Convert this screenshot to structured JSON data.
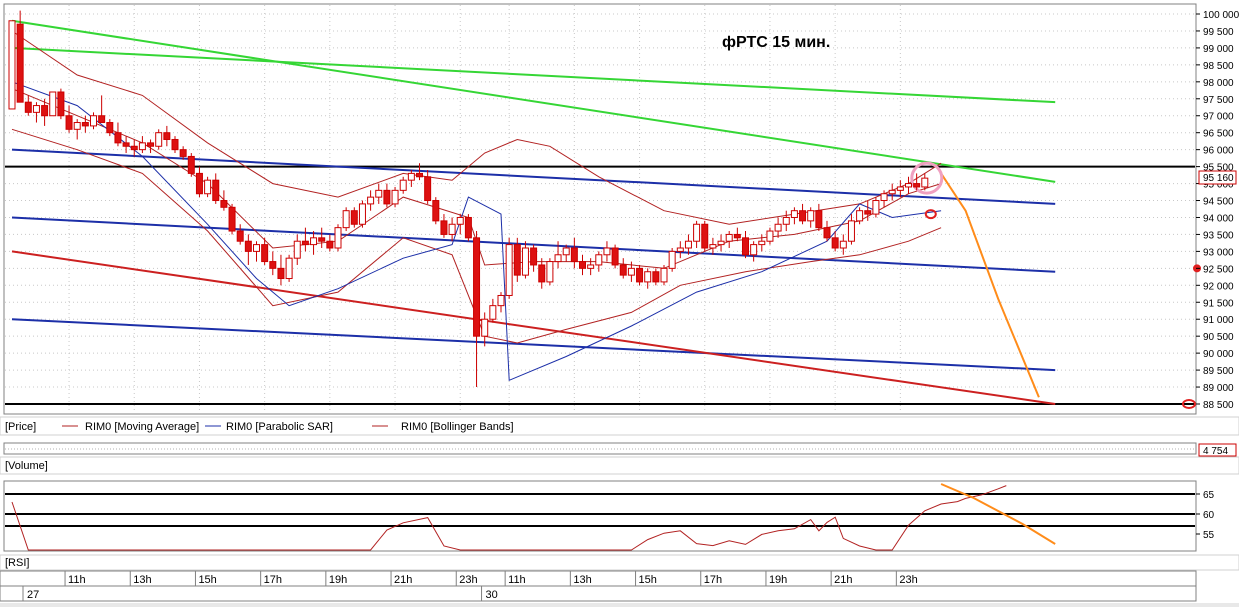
{
  "chart_data": {
    "type": "candlestick",
    "title": "фРТС   15 мин.",
    "instrument": "RIM0",
    "price_axis": {
      "ylim": [
        88500,
        100000
      ],
      "ticks": [
        100000,
        99500,
        99000,
        98500,
        98000,
        97500,
        97000,
        96500,
        96000,
        95500,
        95000,
        94500,
        94000,
        93500,
        93000,
        92500,
        92000,
        91500,
        91000,
        90500,
        90000,
        89500,
        89000,
        88500
      ],
      "tick_labels": [
        "100 000",
        "99 500",
        "99 000",
        "98 500",
        "98 000",
        "97 500",
        "97 000",
        "96 500",
        "96 000",
        "95 500",
        "95 000",
        "94 500",
        "94 000",
        "93 500",
        "93 000",
        "92 500",
        "92 000",
        "91 500",
        "91 000",
        "90 500",
        "90 000",
        "89 500",
        "89 000",
        "88 500"
      ],
      "last_price_label": "95 160",
      "last_price": 95160
    },
    "legend": [
      {
        "label": "[Price]",
        "color": "#000000"
      },
      {
        "label": "RIM0 [Moving Average]",
        "color": "#b22222"
      },
      {
        "label": "RIM0 [Parabolic SAR]",
        "color": "#1c2fa8"
      },
      {
        "label": "RIM0 [Bollinger Bands]",
        "color": "#b22222"
      }
    ],
    "volume_panel": {
      "title": "[Volume]",
      "value_label": "4 754"
    },
    "rsi_panel": {
      "title": "[RSI]",
      "ticks": [
        65,
        60,
        55
      ],
      "levels": [
        65,
        60,
        57
      ],
      "ylim": [
        51,
        68
      ]
    },
    "time_axis": {
      "hour_labels": [
        "11h",
        "13h",
        "15h",
        "17h",
        "19h",
        "21h",
        "23h",
        "11h",
        "13h",
        "15h",
        "17h",
        "19h",
        "21h",
        "23h"
      ],
      "hour_bar_index": [
        7,
        15,
        23,
        31,
        39,
        47,
        55,
        61,
        69,
        77,
        85,
        93,
        101,
        109
      ],
      "date_labels": [
        "27",
        "30"
      ],
      "date_bar_index": [
        0,
        57
      ]
    },
    "candles": [
      [
        97200,
        99700,
        97200,
        99800
      ],
      [
        99700,
        100100,
        99200,
        97400
      ],
      [
        97400,
        97600,
        97000,
        97100
      ],
      [
        97100,
        97400,
        96800,
        97300
      ],
      [
        97300,
        97500,
        96700,
        97000
      ],
      [
        97000,
        97700,
        97000,
        97700
      ],
      [
        97700,
        97800,
        96900,
        97000
      ],
      [
        97000,
        97300,
        96500,
        96600
      ],
      [
        96600,
        96900,
        96300,
        96800
      ],
      [
        96800,
        97000,
        96500,
        96700
      ],
      [
        96700,
        97100,
        96600,
        97000
      ],
      [
        97000,
        97600,
        96900,
        96800
      ],
      [
        96800,
        96900,
        96400,
        96500
      ],
      [
        96500,
        96800,
        96100,
        96200
      ],
      [
        96200,
        96400,
        95900,
        96100
      ],
      [
        96100,
        96300,
        95800,
        96000
      ],
      [
        96000,
        96400,
        95900,
        96200
      ],
      [
        96200,
        96300,
        95900,
        96100
      ],
      [
        96100,
        96600,
        96000,
        96500
      ],
      [
        96500,
        96700,
        96100,
        96300
      ],
      [
        96300,
        96400,
        95900,
        96000
      ],
      [
        96000,
        96100,
        95700,
        95800
      ],
      [
        95800,
        95900,
        95200,
        95300
      ],
      [
        95300,
        95500,
        94600,
        94700
      ],
      [
        94700,
        95200,
        94600,
        95100
      ],
      [
        95100,
        95300,
        94400,
        94500
      ],
      [
        94500,
        94800,
        94200,
        94300
      ],
      [
        94300,
        94400,
        93500,
        93600
      ],
      [
        93600,
        93800,
        93200,
        93300
      ],
      [
        93300,
        93500,
        92600,
        93000
      ],
      [
        93000,
        93300,
        92700,
        93200
      ],
      [
        93200,
        93400,
        92600,
        92700
      ],
      [
        92700,
        93000,
        92300,
        92500
      ],
      [
        92500,
        92900,
        92000,
        92200
      ],
      [
        92200,
        92900,
        92100,
        92800
      ],
      [
        92800,
        93500,
        92600,
        93300
      ],
      [
        93300,
        93700,
        93000,
        93200
      ],
      [
        93200,
        93600,
        92900,
        93400
      ],
      [
        93400,
        93700,
        93100,
        93300
      ],
      [
        93300,
        93500,
        93000,
        93100
      ],
      [
        93100,
        93800,
        93000,
        93700
      ],
      [
        93700,
        94300,
        93600,
        94200
      ],
      [
        94200,
        94300,
        93700,
        93800
      ],
      [
        93800,
        94500,
        93700,
        94400
      ],
      [
        94400,
        94800,
        94200,
        94600
      ],
      [
        94600,
        95000,
        94400,
        94800
      ],
      [
        94800,
        95000,
        94300,
        94400
      ],
      [
        94400,
        94900,
        94300,
        94800
      ],
      [
        94800,
        95200,
        94700,
        95100
      ],
      [
        95100,
        95400,
        94900,
        95300
      ],
      [
        95300,
        95600,
        95100,
        95200
      ],
      [
        95200,
        95400,
        94400,
        94500
      ],
      [
        94500,
        94600,
        93800,
        93900
      ],
      [
        93900,
        94100,
        93400,
        93500
      ],
      [
        93500,
        94000,
        93300,
        93800
      ],
      [
        93800,
        94100,
        93500,
        94000
      ],
      [
        94000,
        94100,
        93300,
        93400
      ],
      [
        93400,
        93600,
        89000,
        90500
      ],
      [
        90500,
        91200,
        90200,
        91000
      ],
      [
        91000,
        91600,
        90900,
        91400
      ],
      [
        91400,
        91800,
        91200,
        91700
      ],
      [
        91700,
        93400,
        91600,
        93200
      ],
      [
        93200,
        93400,
        92100,
        92300
      ],
      [
        92300,
        93300,
        92200,
        93100
      ],
      [
        93100,
        93200,
        92400,
        92600
      ],
      [
        92600,
        92800,
        91900,
        92100
      ],
      [
        92100,
        92800,
        92000,
        92700
      ],
      [
        92700,
        93300,
        92500,
        92900
      ],
      [
        92900,
        93200,
        92700,
        93100
      ],
      [
        93100,
        93400,
        92500,
        92700
      ],
      [
        92700,
        92900,
        92300,
        92500
      ],
      [
        92500,
        92800,
        92300,
        92600
      ],
      [
        92600,
        93000,
        92400,
        92900
      ],
      [
        92900,
        93300,
        92700,
        93100
      ],
      [
        93100,
        93200,
        92500,
        92600
      ],
      [
        92600,
        92800,
        92200,
        92300
      ],
      [
        92300,
        92700,
        92100,
        92500
      ],
      [
        92500,
        92600,
        92000,
        92100
      ],
      [
        92100,
        92500,
        91900,
        92400
      ],
      [
        92400,
        92500,
        92000,
        92100
      ],
      [
        92100,
        92600,
        92000,
        92500
      ],
      [
        92500,
        93100,
        92400,
        93000
      ],
      [
        93000,
        93300,
        92800,
        93100
      ],
      [
        93100,
        93500,
        92900,
        93300
      ],
      [
        93300,
        93900,
        93100,
        93800
      ],
      [
        93800,
        93900,
        93000,
        93100
      ],
      [
        93100,
        93400,
        92900,
        93200
      ],
      [
        93200,
        93500,
        93000,
        93300
      ],
      [
        93300,
        93600,
        93100,
        93500
      ],
      [
        93500,
        93700,
        93300,
        93400
      ],
      [
        93400,
        93600,
        92800,
        92900
      ],
      [
        92900,
        93300,
        92700,
        93200
      ],
      [
        93200,
        93500,
        93000,
        93300
      ],
      [
        93300,
        93700,
        93200,
        93600
      ],
      [
        93600,
        94000,
        93400,
        93800
      ],
      [
        93800,
        94200,
        93600,
        94000
      ],
      [
        94000,
        94300,
        93800,
        94200
      ],
      [
        94200,
        94400,
        93800,
        93900
      ],
      [
        93900,
        94300,
        93700,
        94200
      ],
      [
        94200,
        94400,
        93600,
        93700
      ],
      [
        93700,
        93900,
        93300,
        93400
      ],
      [
        93400,
        93600,
        93000,
        93100
      ],
      [
        93100,
        93500,
        92900,
        93300
      ],
      [
        93300,
        94100,
        93200,
        93900
      ],
      [
        93900,
        94300,
        93800,
        94200
      ],
      [
        94200,
        94500,
        93900,
        94100
      ],
      [
        94100,
        94600,
        94000,
        94500
      ],
      [
        94500,
        94800,
        94300,
        94700
      ],
      [
        94700,
        95000,
        94500,
        94800
      ],
      [
        94800,
        95100,
        94600,
        94900
      ],
      [
        94900,
        95200,
        94700,
        95000
      ],
      [
        95000,
        95300,
        94800,
        94900
      ],
      [
        94900,
        95300,
        94800,
        95160
      ]
    ],
    "moving_average": [
      [
        0,
        97800
      ],
      [
        8,
        97000
      ],
      [
        16,
        96200
      ],
      [
        24,
        95000
      ],
      [
        32,
        93100
      ],
      [
        40,
        93300
      ],
      [
        48,
        94600
      ],
      [
        56,
        94000
      ],
      [
        58,
        92600
      ],
      [
        64,
        92700
      ],
      [
        72,
        92700
      ],
      [
        80,
        92500
      ],
      [
        88,
        93300
      ],
      [
        96,
        93500
      ],
      [
        104,
        93900
      ],
      [
        110,
        94700
      ],
      [
        114,
        95000
      ]
    ],
    "bollinger_upper": [
      [
        0,
        99500
      ],
      [
        8,
        98200
      ],
      [
        16,
        97600
      ],
      [
        24,
        96200
      ],
      [
        32,
        95000
      ],
      [
        40,
        94600
      ],
      [
        48,
        95300
      ],
      [
        54,
        95100
      ],
      [
        58,
        95900
      ],
      [
        62,
        96300
      ],
      [
        66,
        96100
      ],
      [
        72,
        95200
      ],
      [
        80,
        94200
      ],
      [
        88,
        93800
      ],
      [
        96,
        94100
      ],
      [
        104,
        94400
      ],
      [
        110,
        95000
      ],
      [
        114,
        95600
      ]
    ],
    "bollinger_lower": [
      [
        0,
        96600
      ],
      [
        8,
        96000
      ],
      [
        16,
        95300
      ],
      [
        24,
        93600
      ],
      [
        32,
        91400
      ],
      [
        40,
        91800
      ],
      [
        48,
        93400
      ],
      [
        54,
        92900
      ],
      [
        58,
        90500
      ],
      [
        62,
        90300
      ],
      [
        68,
        90700
      ],
      [
        76,
        91200
      ],
      [
        82,
        92000
      ],
      [
        90,
        92400
      ],
      [
        98,
        92700
      ],
      [
        104,
        92900
      ],
      [
        110,
        93300
      ],
      [
        114,
        93700
      ]
    ],
    "parabolic_sar": [
      [
        0,
        98000
      ],
      [
        8,
        97300
      ],
      [
        16,
        95800
      ],
      [
        24,
        93800
      ],
      [
        30,
        92200
      ],
      [
        34,
        91400
      ],
      [
        40,
        91900
      ],
      [
        48,
        92800
      ],
      [
        54,
        93200
      ],
      [
        56,
        94600
      ],
      [
        60,
        94100
      ],
      [
        61,
        89200
      ],
      [
        68,
        89900
      ],
      [
        76,
        90800
      ],
      [
        84,
        91800
      ],
      [
        92,
        92400
      ],
      [
        100,
        93300
      ],
      [
        104,
        94400
      ],
      [
        108,
        94000
      ],
      [
        114,
        94200
      ]
    ],
    "annotation_lines": [
      {
        "color": "#35d635",
        "from": [
          0,
          99800
        ],
        "to": [
          128,
          95050
        ]
      },
      {
        "color": "#35d635",
        "from": [
          0,
          99000
        ],
        "to": [
          128,
          97400
        ]
      },
      {
        "color": "#1c2fa8",
        "from": [
          0,
          96000
        ],
        "to": [
          128,
          94400
        ]
      },
      {
        "color": "#1c2fa8",
        "from": [
          0,
          94000
        ],
        "to": [
          128,
          92400
        ]
      },
      {
        "color": "#1c2fa8",
        "from": [
          0,
          91000
        ],
        "to": [
          128,
          89500
        ]
      },
      {
        "color": "#cc2020",
        "from": [
          0,
          93000
        ],
        "to": [
          128,
          88500
        ]
      }
    ],
    "horizontal_levels": [
      95500,
      88500
    ],
    "forecast_price": [
      [
        114,
        95300
      ],
      [
        117,
        94200
      ],
      [
        121,
        91600
      ],
      [
        126,
        88700
      ]
    ],
    "forecast_rsi": [
      [
        114,
        67.5
      ],
      [
        118,
        64
      ],
      [
        124,
        57.5
      ],
      [
        128,
        52.5
      ]
    ],
    "rsi_values": [
      [
        0,
        63
      ],
      [
        2,
        51
      ],
      [
        18,
        51
      ],
      [
        44,
        51
      ],
      [
        46,
        56
      ],
      [
        48,
        57.8
      ],
      [
        51,
        59.1
      ],
      [
        53,
        52
      ],
      [
        55,
        51
      ],
      [
        76,
        51
      ],
      [
        78,
        53.6
      ],
      [
        80,
        55.2
      ],
      [
        82,
        55.8
      ],
      [
        84,
        52.6
      ],
      [
        86,
        52.1
      ],
      [
        88,
        53.3
      ],
      [
        90,
        52.4
      ],
      [
        92,
        54.9
      ],
      [
        94,
        55.8
      ],
      [
        96,
        56.3
      ],
      [
        98,
        58.6
      ],
      [
        99,
        55.8
      ],
      [
        100,
        57.9
      ],
      [
        101,
        59.2
      ],
      [
        102,
        53.9
      ],
      [
        104,
        52
      ],
      [
        106,
        51
      ],
      [
        108,
        51
      ],
      [
        110,
        57.2
      ],
      [
        112,
        60.8
      ],
      [
        114,
        62.5
      ],
      [
        116,
        63.1
      ],
      [
        117,
        63.9
      ],
      [
        119,
        64.8
      ],
      [
        121,
        66.3
      ],
      [
        122,
        67.1
      ]
    ]
  }
}
